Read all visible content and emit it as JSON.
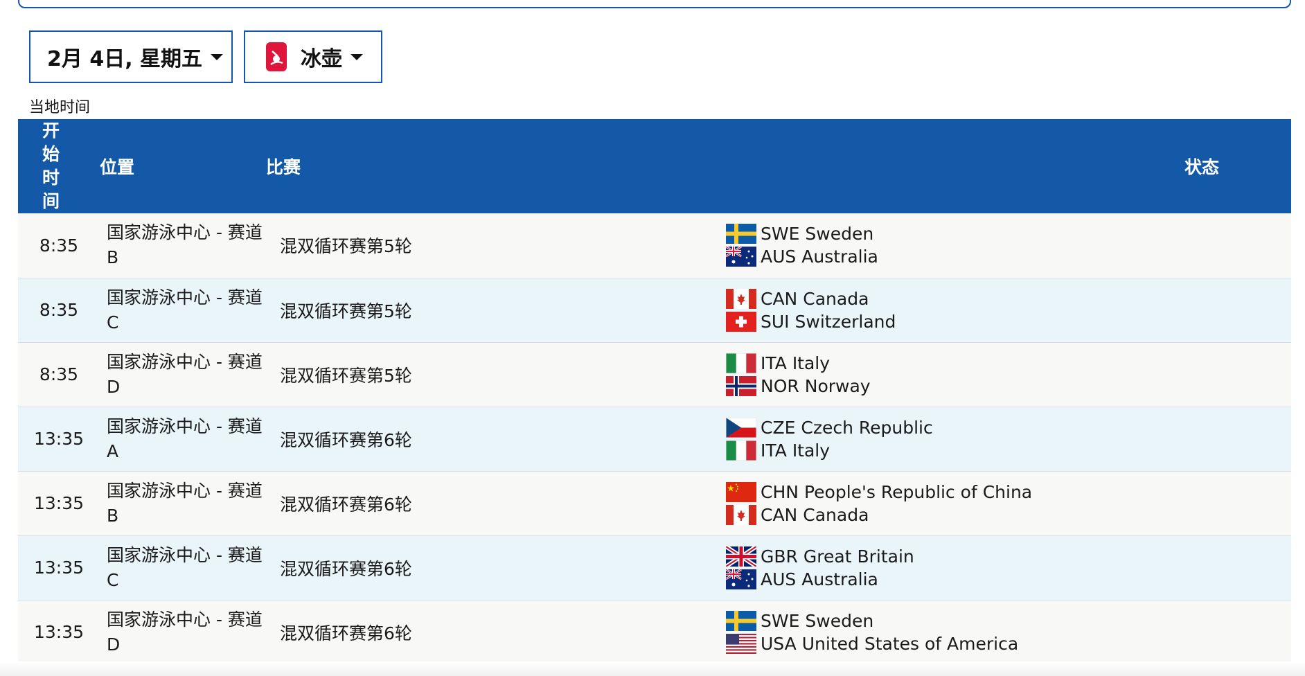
{
  "filters": {
    "date_label": "2月 4日, 星期五",
    "sport_label": "冰壶",
    "sport_icon": "curling-icon"
  },
  "timezone_note": "当地时间",
  "table": {
    "headers": {
      "start_time": "开始时间",
      "venue": "位置",
      "event": "比赛",
      "status": "状态"
    },
    "rows": [
      {
        "time": "8:35",
        "venue": "国家游泳中心 - 赛道B",
        "event": "混双循环赛第5轮",
        "teams": [
          {
            "code": "SWE",
            "name": "Sweden",
            "flag": "swe"
          },
          {
            "code": "AUS",
            "name": "Australia",
            "flag": "aus"
          }
        ]
      },
      {
        "time": "8:35",
        "venue": "国家游泳中心 - 赛道C",
        "event": "混双循环赛第5轮",
        "teams": [
          {
            "code": "CAN",
            "name": "Canada",
            "flag": "can"
          },
          {
            "code": "SUI",
            "name": "Switzerland",
            "flag": "sui"
          }
        ]
      },
      {
        "time": "8:35",
        "venue": "国家游泳中心 - 赛道D",
        "event": "混双循环赛第5轮",
        "teams": [
          {
            "code": "ITA",
            "name": "Italy",
            "flag": "ita"
          },
          {
            "code": "NOR",
            "name": "Norway",
            "flag": "nor"
          }
        ]
      },
      {
        "time": "13:35",
        "venue": "国家游泳中心 - 赛道A",
        "event": "混双循环赛第6轮",
        "teams": [
          {
            "code": "CZE",
            "name": "Czech Republic",
            "flag": "cze"
          },
          {
            "code": "ITA",
            "name": "Italy",
            "flag": "ita"
          }
        ]
      },
      {
        "time": "13:35",
        "venue": "国家游泳中心 - 赛道B",
        "event": "混双循环赛第6轮",
        "teams": [
          {
            "code": "CHN",
            "name": "People's Republic of China",
            "flag": "chn"
          },
          {
            "code": "CAN",
            "name": "Canada",
            "flag": "can"
          }
        ]
      },
      {
        "time": "13:35",
        "venue": "国家游泳中心 - 赛道C",
        "event": "混双循环赛第6轮",
        "teams": [
          {
            "code": "GBR",
            "name": "Great Britain",
            "flag": "gbr"
          },
          {
            "code": "AUS",
            "name": "Australia",
            "flag": "aus"
          }
        ]
      },
      {
        "time": "13:35",
        "venue": "国家游泳中心 - 赛道D",
        "event": "混双循环赛第6轮",
        "teams": [
          {
            "code": "SWE",
            "name": "Sweden",
            "flag": "swe"
          },
          {
            "code": "USA",
            "name": "United States of America",
            "flag": "usa"
          }
        ]
      }
    ]
  },
  "colors": {
    "accent_blue": "#1458a8",
    "row_odd": "#f8f8f6",
    "row_even": "#eaf5fa",
    "sport_red": "#e0153c"
  }
}
